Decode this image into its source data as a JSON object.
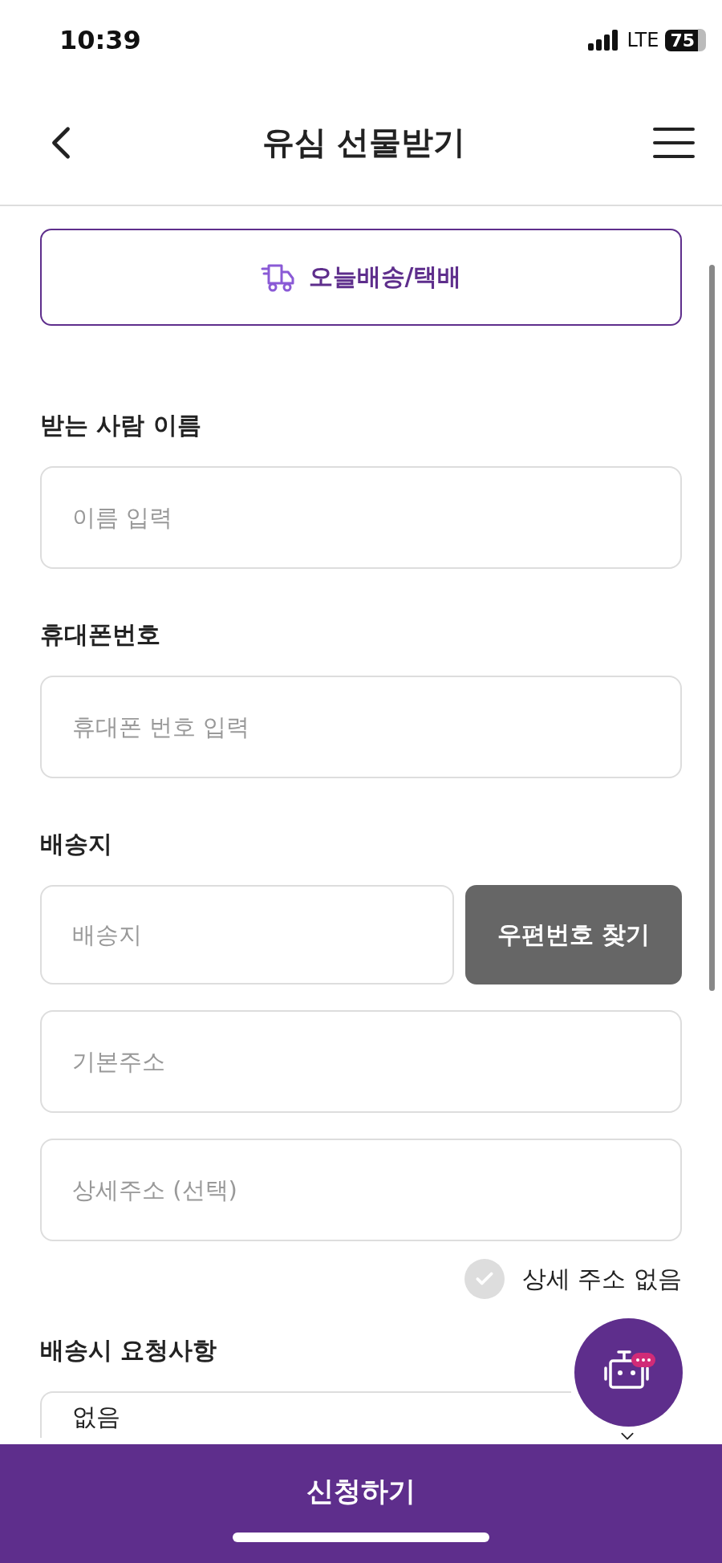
{
  "status_bar": {
    "time": "10:39",
    "network": "LTE",
    "battery": "75"
  },
  "header": {
    "title": "유심 선물받기"
  },
  "delivery_option": {
    "label": "오늘배송/택배",
    "selected": true
  },
  "form": [
    {
      "kind": "text",
      "label": "받는 사람 이름",
      "placeholder": "이름 입력"
    },
    {
      "kind": "text",
      "label": "휴대폰번호",
      "placeholder": "휴대폰 번호 입력"
    },
    {
      "kind": "address",
      "label": "배송지",
      "postcode_placeholder": "배송지",
      "search_button": "우편번호 찾기",
      "base_placeholder": "기본주소",
      "detail_placeholder": "상세주소 (선택)",
      "no_detail": {
        "label": "상세 주소 없음",
        "checked": false
      }
    },
    {
      "kind": "select",
      "label": "배송시 요청사항",
      "value": "없음"
    }
  ],
  "submit_button": "신청하기"
}
